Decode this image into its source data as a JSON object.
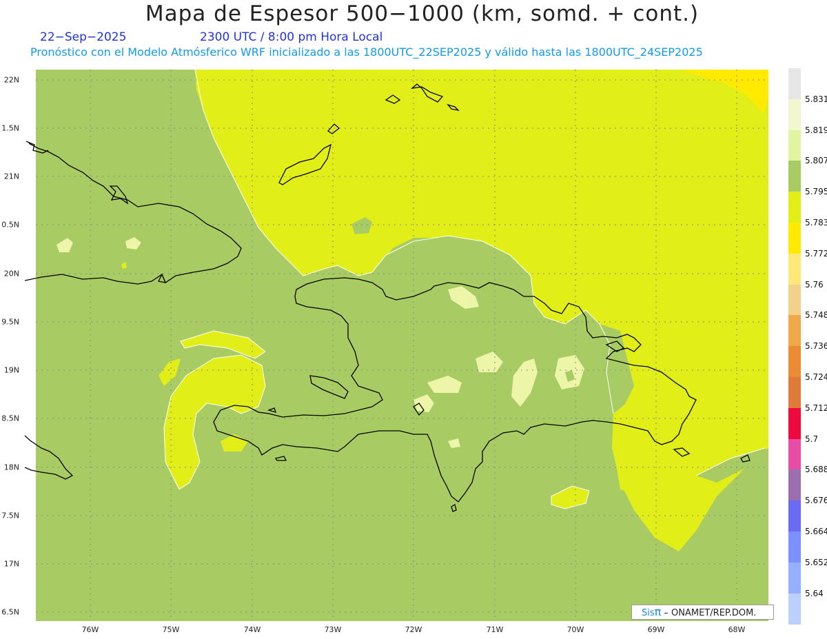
{
  "header": {
    "title": "Mapa de Espesor 500−1000 (km, somd. + cont.)",
    "date": "22−Sep−2025",
    "time": "2300 UTC / 8:00 pm Hora Local",
    "description": "Pronóstico con el Modelo Atmósferico WRF inicializado a las 1800UTC_22SEP2025 y válido hasta las  1800UTC_24SEP2025"
  },
  "map": {
    "lat_labels": [
      "22N",
      "1.5N",
      "21N",
      "0.5N",
      "20N",
      "9.5N",
      "19N",
      "8.5N",
      "18N",
      "7.5N",
      "17N",
      "6.5N"
    ],
    "lon_labels": [
      "76W",
      "75W",
      "74W",
      "73W",
      "72W",
      "71W",
      "70W",
      "69W",
      "68W"
    ],
    "colors": {
      "base": "#a9cb63",
      "yellow": "#e2ee18",
      "pale": "#ecf5a8",
      "bright_yellow": "#ffea00",
      "coast": "#000000",
      "grid": "#888888"
    }
  },
  "colorbar": {
    "labels": [
      "5.831",
      "5.819",
      "5.807",
      "5.795",
      "5.783",
      "5.772",
      "5.76",
      "5.748",
      "5.736",
      "5.724",
      "5.712",
      "5.7",
      "5.688",
      "5.676",
      "5.664",
      "5.652",
      "5.64"
    ],
    "colors": [
      "#e6e6e6",
      "#f3f7d0",
      "#e2f3a2",
      "#a9cb63",
      "#e2ee18",
      "#ffea00",
      "#ffe87a",
      "#f2d18a",
      "#f0a94a",
      "#ea8c34",
      "#df7a3a",
      "#ee0a3e",
      "#e84da6",
      "#9b6faf",
      "#6a6af3",
      "#7d90ff",
      "#94b0ff",
      "#bcd0ff"
    ]
  },
  "credit": {
    "sis": "Sis",
    "pi": "π",
    "rest": "– ONAMET/REP.DOM."
  }
}
